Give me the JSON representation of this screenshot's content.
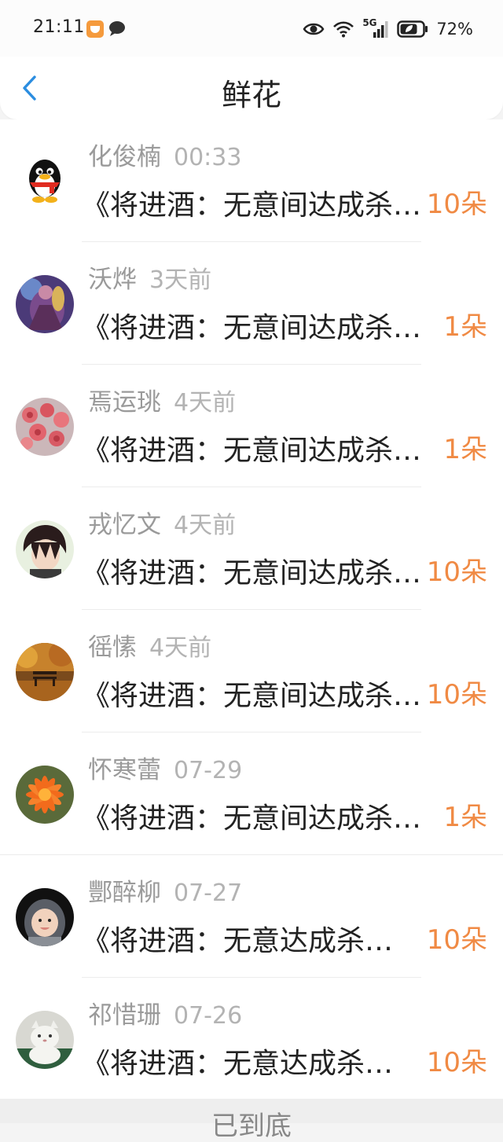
{
  "status_bar": {
    "time": "21:11",
    "battery_percent": "72%",
    "network": "5G",
    "icons": [
      "app-notification-icon",
      "chat-icon",
      "eye-icon",
      "wifi-icon",
      "signal-icon",
      "battery-icon"
    ]
  },
  "header": {
    "title": "鲜花",
    "back_icon": "chevron-left-icon"
  },
  "colors": {
    "accent": "#2b8de0",
    "count": "#f08a44",
    "name": "#9a9a9a",
    "time": "#b3b3b3"
  },
  "rows": [
    {
      "name": "化俊楠",
      "time": "00:33",
      "message": "《将进酒：无意间达成杀…",
      "count": "10朵",
      "avatar": "qq-penguin-avatar"
    },
    {
      "name": "沃烨",
      "time": "3天前",
      "message": "《将进酒：无意间达成杀…",
      "count": "1朵",
      "avatar": "game-character-avatar"
    },
    {
      "name": "焉运珧",
      "time": "4天前",
      "message": "《将进酒：无意间达成杀…",
      "count": "1朵",
      "avatar": "roses-avatar"
    },
    {
      "name": "戎忆文",
      "time": "4天前",
      "message": "《将进酒：无意间达成杀…",
      "count": "10朵",
      "avatar": "anime-boy-avatar"
    },
    {
      "name": "徭愫",
      "time": "4天前",
      "message": "《将进酒：无意间达成杀…",
      "count": "10朵",
      "avatar": "autumn-bench-avatar"
    },
    {
      "name": "怀寒蕾",
      "time": "07-29",
      "message": "《将进酒：无意间达成杀…",
      "count": "1朵",
      "avatar": "orange-flower-avatar"
    },
    {
      "name": "酆醉柳",
      "time": "07-27",
      "message": "《将进酒：无意达成杀…",
      "count": "10朵",
      "avatar": "baby-avatar"
    },
    {
      "name": "祁惜珊",
      "time": "07-26",
      "message": "《将进酒：无意达成杀…",
      "count": "10朵",
      "avatar": "cat-avatar"
    }
  ],
  "footer": {
    "hint": "已到底"
  }
}
